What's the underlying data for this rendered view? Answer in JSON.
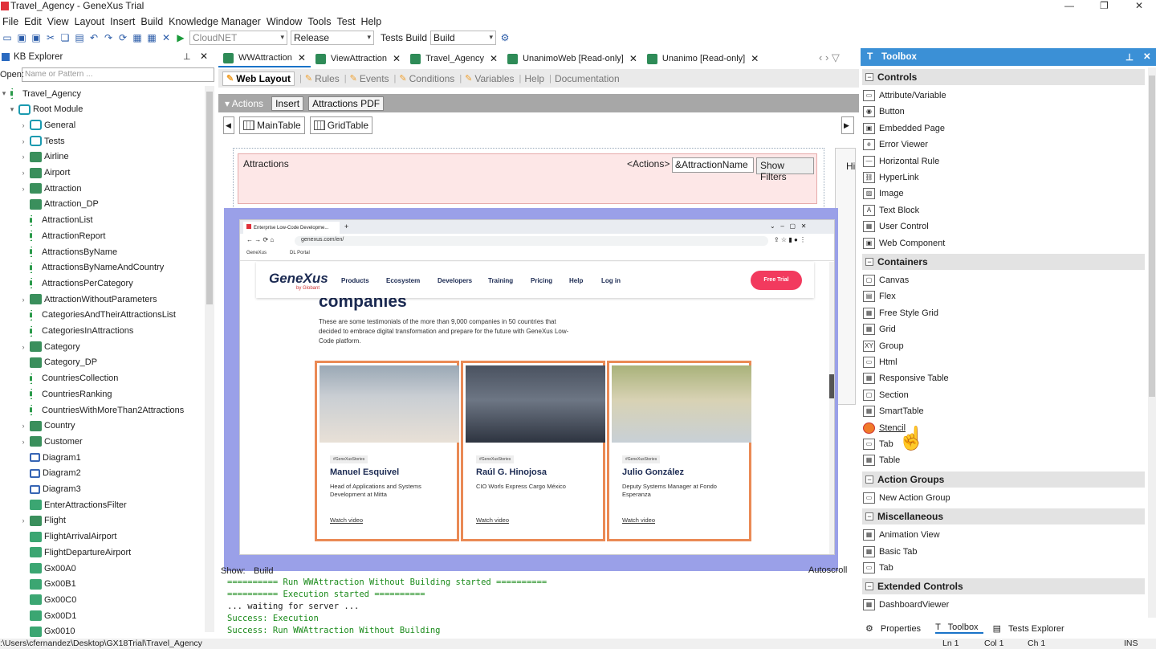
{
  "window": {
    "title": "Travel_Agency - GeneXus Trial"
  },
  "menu": [
    "File",
    "Edit",
    "View",
    "Layout",
    "Insert",
    "Build",
    "Knowledge Manager",
    "Window",
    "Tools",
    "Test",
    "Help"
  ],
  "toolbar": {
    "env": "CloudNET",
    "config": "Release",
    "tests_label": "Tests Build",
    "build_sel": "Build"
  },
  "kb": {
    "title": "KB Explorer",
    "open_label": "Open:",
    "open_placeholder": "Name or Pattern ..."
  },
  "tree": [
    {
      "label": "Travel_Agency",
      "indent": 0,
      "chev": "▾",
      "icon": "kb"
    },
    {
      "label": "Root Module",
      "indent": 1,
      "chev": "▾",
      "icon": "pkg"
    },
    {
      "label": "General",
      "indent": 2,
      "chev": "›",
      "icon": "pkg"
    },
    {
      "label": "Tests",
      "indent": 2,
      "chev": "›",
      "icon": "pkg"
    },
    {
      "label": "Airline",
      "indent": 2,
      "chev": "›",
      "icon": "obj"
    },
    {
      "label": "Airport",
      "indent": 2,
      "chev": "›",
      "icon": "obj"
    },
    {
      "label": "Attraction",
      "indent": 2,
      "chev": "›",
      "icon": "obj"
    },
    {
      "label": "Attraction_DP",
      "indent": 2,
      "chev": "",
      "icon": "obj"
    },
    {
      "label": "AttractionList",
      "indent": 2,
      "chev": "",
      "icon": "proc"
    },
    {
      "label": "AttractionReport",
      "indent": 2,
      "chev": "",
      "icon": "proc"
    },
    {
      "label": "AttractionsByName",
      "indent": 2,
      "chev": "",
      "icon": "proc"
    },
    {
      "label": "AttractionsByNameAndCountry",
      "indent": 2,
      "chev": "",
      "icon": "proc"
    },
    {
      "label": "AttractionsPerCategory",
      "indent": 2,
      "chev": "",
      "icon": "proc"
    },
    {
      "label": "AttractionWithoutParameters",
      "indent": 2,
      "chev": "›",
      "icon": "obj"
    },
    {
      "label": "CategoriesAndTheirAttractionsList",
      "indent": 2,
      "chev": "",
      "icon": "proc"
    },
    {
      "label": "CategoriesInAttractions",
      "indent": 2,
      "chev": "",
      "icon": "proc"
    },
    {
      "label": "Category",
      "indent": 2,
      "chev": "›",
      "icon": "obj"
    },
    {
      "label": "Category_DP",
      "indent": 2,
      "chev": "",
      "icon": "obj"
    },
    {
      "label": "CountriesCollection",
      "indent": 2,
      "chev": "",
      "icon": "proc"
    },
    {
      "label": "CountriesRanking",
      "indent": 2,
      "chev": "",
      "icon": "proc"
    },
    {
      "label": "CountriesWithMoreThan2Attractions",
      "indent": 2,
      "chev": "",
      "icon": "proc"
    },
    {
      "label": "Country",
      "indent": 2,
      "chev": "›",
      "icon": "obj"
    },
    {
      "label": "Customer",
      "indent": 2,
      "chev": "›",
      "icon": "obj"
    },
    {
      "label": "Diagram1",
      "indent": 2,
      "chev": "",
      "icon": "diag"
    },
    {
      "label": "Diagram2",
      "indent": 2,
      "chev": "",
      "icon": "diag"
    },
    {
      "label": "Diagram3",
      "indent": 2,
      "chev": "",
      "icon": "diag"
    },
    {
      "label": "EnterAttractionsFilter",
      "indent": 2,
      "chev": "",
      "icon": "wp"
    },
    {
      "label": "Flight",
      "indent": 2,
      "chev": "›",
      "icon": "obj"
    },
    {
      "label": "FlightArrivalAirport",
      "indent": 2,
      "chev": "",
      "icon": "wp"
    },
    {
      "label": "FlightDepartureAirport",
      "indent": 2,
      "chev": "",
      "icon": "wp"
    },
    {
      "label": "Gx00A0",
      "indent": 2,
      "chev": "",
      "icon": "wp"
    },
    {
      "label": "Gx00B1",
      "indent": 2,
      "chev": "",
      "icon": "wp"
    },
    {
      "label": "Gx00C0",
      "indent": 2,
      "chev": "",
      "icon": "wp"
    },
    {
      "label": "Gx00D1",
      "indent": 2,
      "chev": "",
      "icon": "wp"
    },
    {
      "label": "Gx0010",
      "indent": 2,
      "chev": "",
      "icon": "wp"
    }
  ],
  "tabs": [
    "WWAttraction",
    "ViewAttraction",
    "Travel_Agency",
    "UnanimoWeb [Read-only]",
    "Unanimo [Read-only]"
  ],
  "subtabs": [
    "Web Layout",
    "Rules",
    "Events",
    "Conditions",
    "Variables",
    "Help",
    "Documentation"
  ],
  "actions": {
    "label": "Actions",
    "insert": "Insert",
    "pdf": "Attractions PDF"
  },
  "tablebtns": [
    "MainTable",
    "GridTable"
  ],
  "designer": {
    "attractions": "Attractions",
    "actions_tag": "<Actions>",
    "attr_name": "&AttractionName",
    "show_filters": "Show Filters",
    "hi": "Hi"
  },
  "browser": {
    "tab_title": "Enterprise Low-Code Developme...",
    "url": "genexus.com/en/",
    "bookmarks": [
      "GeneXus",
      "DL Portal"
    ],
    "logo": "GeneXus",
    "logo_sub": "by Globant",
    "nav": [
      "Products",
      "Ecosystem",
      "Developers",
      "Training",
      "Pricing",
      "Help",
      "Log in"
    ],
    "trial": "Free Trial",
    "heading": "companies",
    "lead": "These are some testimonials of the more than 9,000 companies in 50 countries that decided to embrace digital transformation and prepare for the future with GeneXus Low-Code platform.",
    "cards": [
      {
        "tag": "#GeneXusStories",
        "name": "Manuel Esquivel",
        "role": "Head of Applications and Systems Development at Mitta",
        "link": "Watch video"
      },
      {
        "tag": "#GeneXusStories",
        "name": "Raúl G. Hinojosa",
        "role": "CIO Worls Express Cargo México",
        "link": "Watch video"
      },
      {
        "tag": "#GeneXusStories",
        "name": "Julio González",
        "role": "Deputy Systems Manager at Fondo Esperanza",
        "link": "Watch video"
      }
    ]
  },
  "output": {
    "show_label": "Show:",
    "show_value": "Build",
    "autoscroll": "Autoscroll",
    "lines": [
      "========== Run WWAttraction Without Building started ==========",
      "========== Execution started ==========",
      "... waiting for server ...",
      "Success: Execution",
      "Success: Run WWAttraction Without Building"
    ]
  },
  "toolbox": {
    "title": "Toolbox",
    "sections": [
      {
        "name": "Controls",
        "items": [
          "Attribute/Variable",
          "Button",
          "Embedded Page",
          "Error Viewer",
          "Horizontal Rule",
          "HyperLink",
          "Image",
          "Text Block",
          "User Control",
          "Web Component"
        ]
      },
      {
        "name": "Containers",
        "items": [
          "Canvas",
          "Flex",
          "Free Style Grid",
          "Grid",
          "Group",
          "Html",
          "Responsive Table",
          "Section",
          "SmartTable",
          "Stencil",
          "Tab",
          "Table"
        ]
      },
      {
        "name": "Action Groups",
        "items": [
          "New Action Group"
        ]
      },
      {
        "name": "Miscellaneous",
        "items": [
          "Animation View",
          "Basic Tab",
          "Tab"
        ]
      },
      {
        "name": "Extended Controls",
        "items": [
          "DashboardViewer"
        ]
      }
    ],
    "footer": [
      "Properties",
      "Toolbox",
      "Tests Explorer"
    ]
  },
  "status": {
    "path": ":\\Users\\cfernandez\\Desktop\\GX18Trial\\Travel_Agency",
    "ln": "Ln 1",
    "col": "Col 1",
    "ch": "Ch 1",
    "ins": "INS"
  }
}
